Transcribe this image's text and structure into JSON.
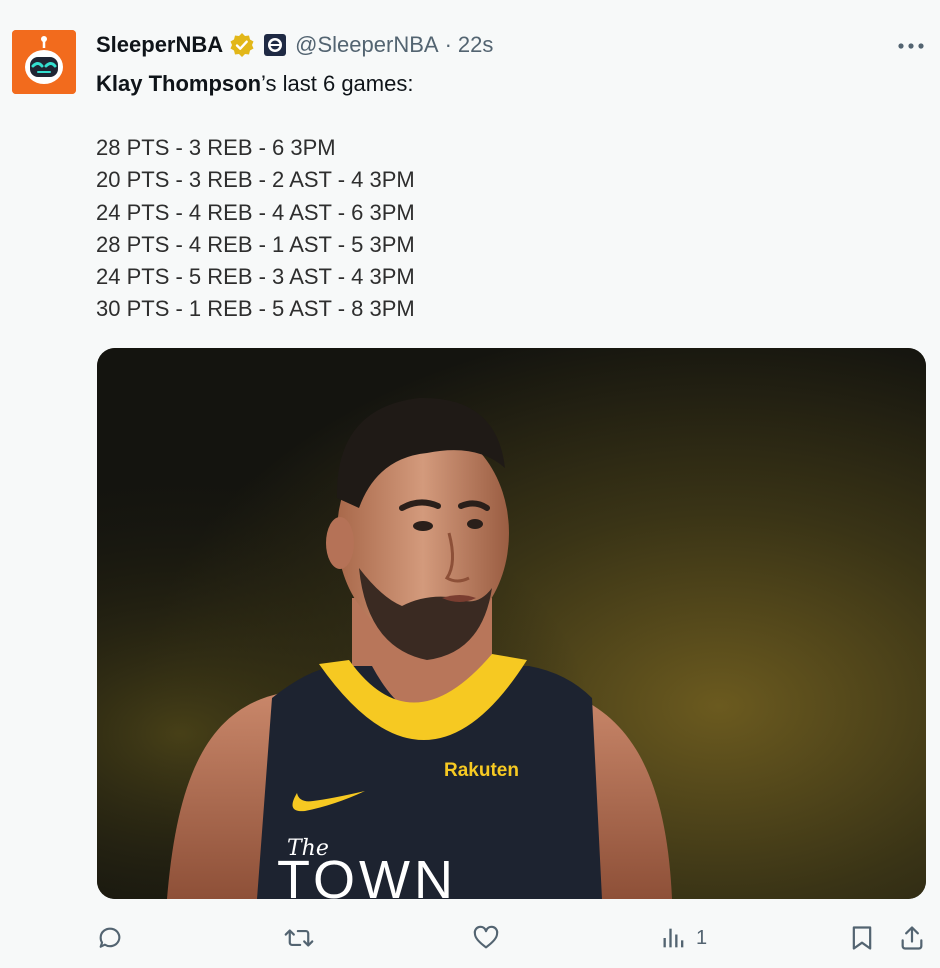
{
  "tweet": {
    "display_name": "SleeperNBA",
    "handle": "@SleeperNBA",
    "separator": "·",
    "time": "22s",
    "bold_name": "Klay Thompson",
    "intro_rest": "’s last 6 games:",
    "stat_lines": [
      "28 PTS - 3 REB - 6 3PM",
      "20 PTS - 3 REB - 2 AST - 4 3PM",
      "24 PTS - 4 REB - 4 AST - 6 3PM",
      "28 PTS - 4 REB - 1 AST - 5 3PM",
      "24 PTS - 5 REB - 3 AST - 4 3PM",
      "30 PTS - 1 REB - 5 AST - 8 3PM"
    ],
    "media": {
      "jersey_sponsor": "Rakuten",
      "jersey_the": "The",
      "jersey_town": "TOWN"
    }
  },
  "actions": {
    "views_count": "1"
  },
  "icons": {
    "avatar": "sleeper-robot-logo",
    "verified": "gold-verified-badge",
    "affiliate": "nba-team-affiliate-badge",
    "more": "more-horizontal-icon",
    "reply": "reply-icon",
    "retweet": "retweet-icon",
    "like": "heart-icon",
    "views": "analytics-icon",
    "bookmark": "bookmark-icon",
    "share": "share-icon"
  },
  "colors": {
    "background": "#f7f9f9",
    "text": "#0f1419",
    "secondary": "#536471",
    "avatar_orange": "#f26b1d",
    "verified_gold": "#e2b719",
    "jersey_navy": "#1d2330",
    "jersey_gold": "#f6c922"
  }
}
